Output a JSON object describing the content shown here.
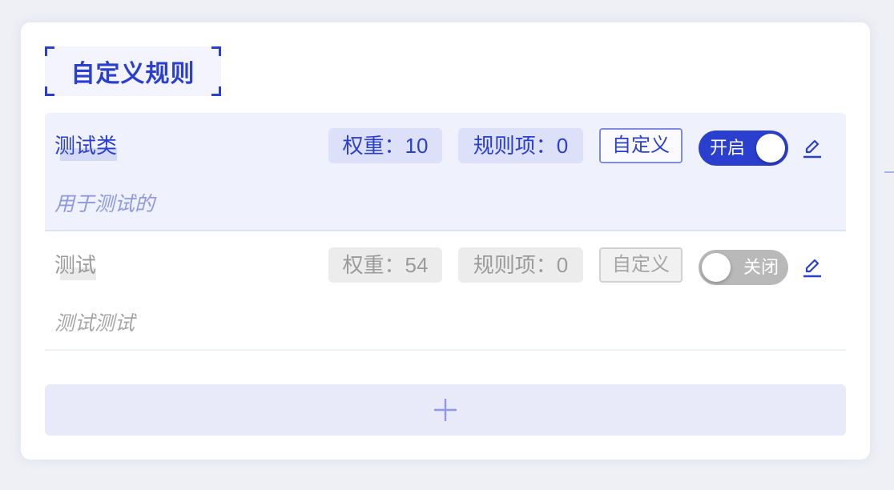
{
  "section": {
    "title": "自定义规则"
  },
  "colors": {
    "accent": "#2b3fcf",
    "enabled_bg": "#eff1fc",
    "disabled_toggle": "#b9b9b9"
  },
  "rules": [
    {
      "name": "测试类",
      "description": "用于测试的",
      "weight_label": "权重：10",
      "weight": 10,
      "items_label": "规则项：0",
      "items": 0,
      "custom_label": "自定义",
      "toggle_label": "开启",
      "enabled": true,
      "edit_icon": "pencil-icon"
    },
    {
      "name": "测试",
      "description": "测试测试",
      "weight_label": "权重：54",
      "weight": 54,
      "items_label": "规则项：0",
      "items": 0,
      "custom_label": "自定义",
      "toggle_label": "关闭",
      "enabled": false,
      "edit_icon": "pencil-icon"
    }
  ],
  "add_button": {
    "icon": "plus-icon"
  }
}
